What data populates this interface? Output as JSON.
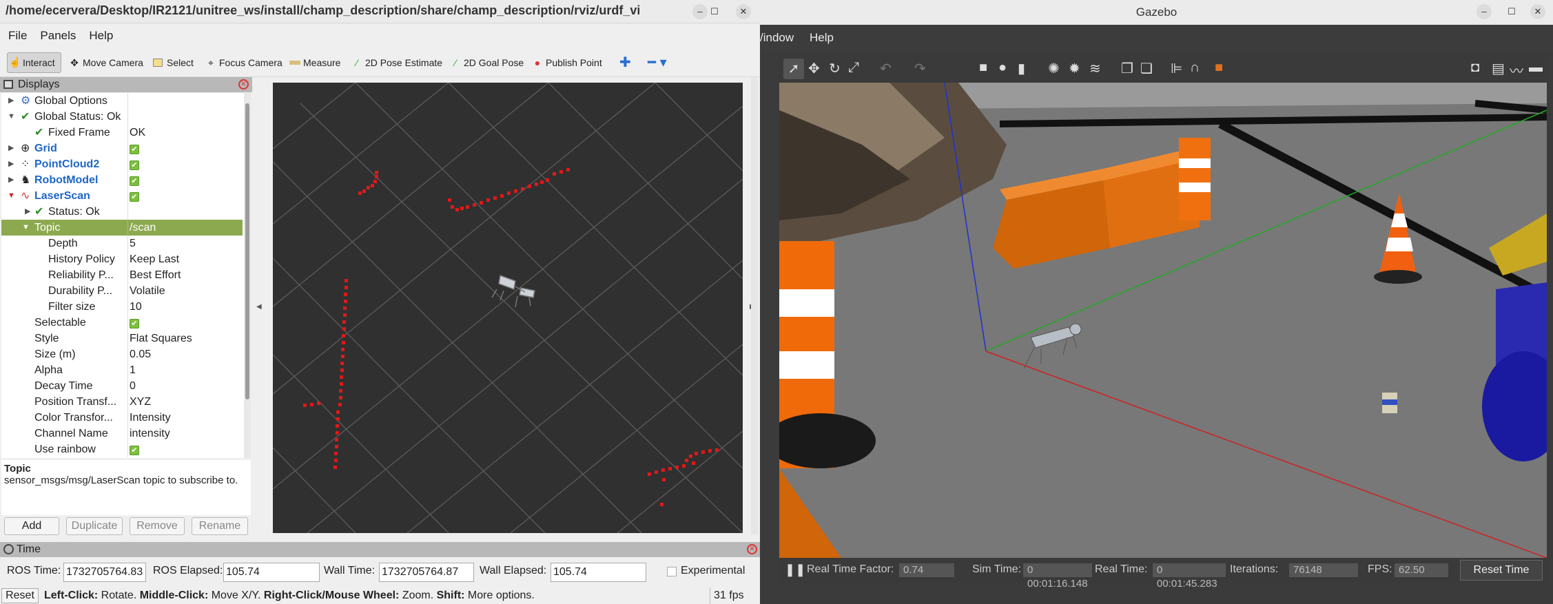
{
  "rviz": {
    "title": "/home/ecervera/Desktop/IR2121/unitree_ws/install/champ_description/share/champ_description/rviz/urdf_viewer.rviz* - R",
    "menu": [
      "File",
      "Panels",
      "Help"
    ],
    "tools": {
      "interact": "Interact",
      "move_camera": "Move Camera",
      "select": "Select",
      "focus_camera": "Focus Camera",
      "measure": "Measure",
      "pose_estimate": "2D Pose Estimate",
      "goal_pose": "2D Goal Pose",
      "publish_point": "Publish Point"
    },
    "displays_title": "Displays",
    "tree": {
      "global_options": "Global Options",
      "global_status": "Global Status: Ok",
      "fixed_frame": "Fixed Frame",
      "fixed_frame_val": "OK",
      "grid": "Grid",
      "pointcloud": "PointCloud2",
      "robotmodel": "RobotModel",
      "laserscan": "LaserScan",
      "status": "Status: Ok",
      "topic": "Topic",
      "topic_val": "/scan",
      "depth": "Depth",
      "depth_val": "5",
      "history": "History Policy",
      "history_val": "Keep Last",
      "reliability": "Reliability P...",
      "reliability_val": "Best Effort",
      "durability": "Durability P...",
      "durability_val": "Volatile",
      "filter": "Filter size",
      "filter_val": "10",
      "selectable": "Selectable",
      "style": "Style",
      "style_val": "Flat Squares",
      "size": "Size (m)",
      "size_val": "0.05",
      "alpha": "Alpha",
      "alpha_val": "1",
      "decay": "Decay Time",
      "decay_val": "0",
      "position": "Position Transf...",
      "position_val": "XYZ",
      "color": "Color Transfor...",
      "color_val": "Intensity",
      "channel": "Channel Name",
      "channel_val": "intensity",
      "rainbow": "Use rainbow"
    },
    "desc_title": "Topic",
    "desc_text": "sensor_msgs/msg/LaserScan topic to subscribe to.",
    "buttons": {
      "add": "Add",
      "duplicate": "Duplicate",
      "remove": "Remove",
      "rename": "Rename"
    },
    "time_title": "Time",
    "time": {
      "ros_time_label": "ROS Time:",
      "ros_time": "1732705764.83",
      "ros_elapsed_label": "ROS Elapsed:",
      "ros_elapsed": "105.74",
      "wall_time_label": "Wall Time:",
      "wall_time": "1732705764.87",
      "wall_elapsed_label": "Wall Elapsed:",
      "wall_elapsed": "105.74",
      "experimental": "Experimental"
    },
    "status": {
      "reset": "Reset",
      "left": "Left-Click:",
      "left_t": " Rotate. ",
      "middle": "Middle-Click:",
      "middle_t": " Move X/Y. ",
      "right": "Right-Click/Mouse Wheel:",
      "right_t": " Zoom. ",
      "shift": "Shift:",
      "shift_t": " More options.",
      "fps": "31 fps"
    }
  },
  "gazebo": {
    "title": "Gazebo",
    "menu": [
      "/indow",
      "Help"
    ],
    "bottom": {
      "rtf_label": "Real Time Factor:",
      "rtf": "0.74",
      "sim_label": "Sim Time:",
      "sim": "0 00:01:16.148",
      "real_label": "Real Time:",
      "real": "0 00:01:45.283",
      "iter_label": "Iterations:",
      "iter": "76148",
      "fps_label": "FPS:",
      "fps": "62.50",
      "reset": "Reset Time"
    }
  }
}
